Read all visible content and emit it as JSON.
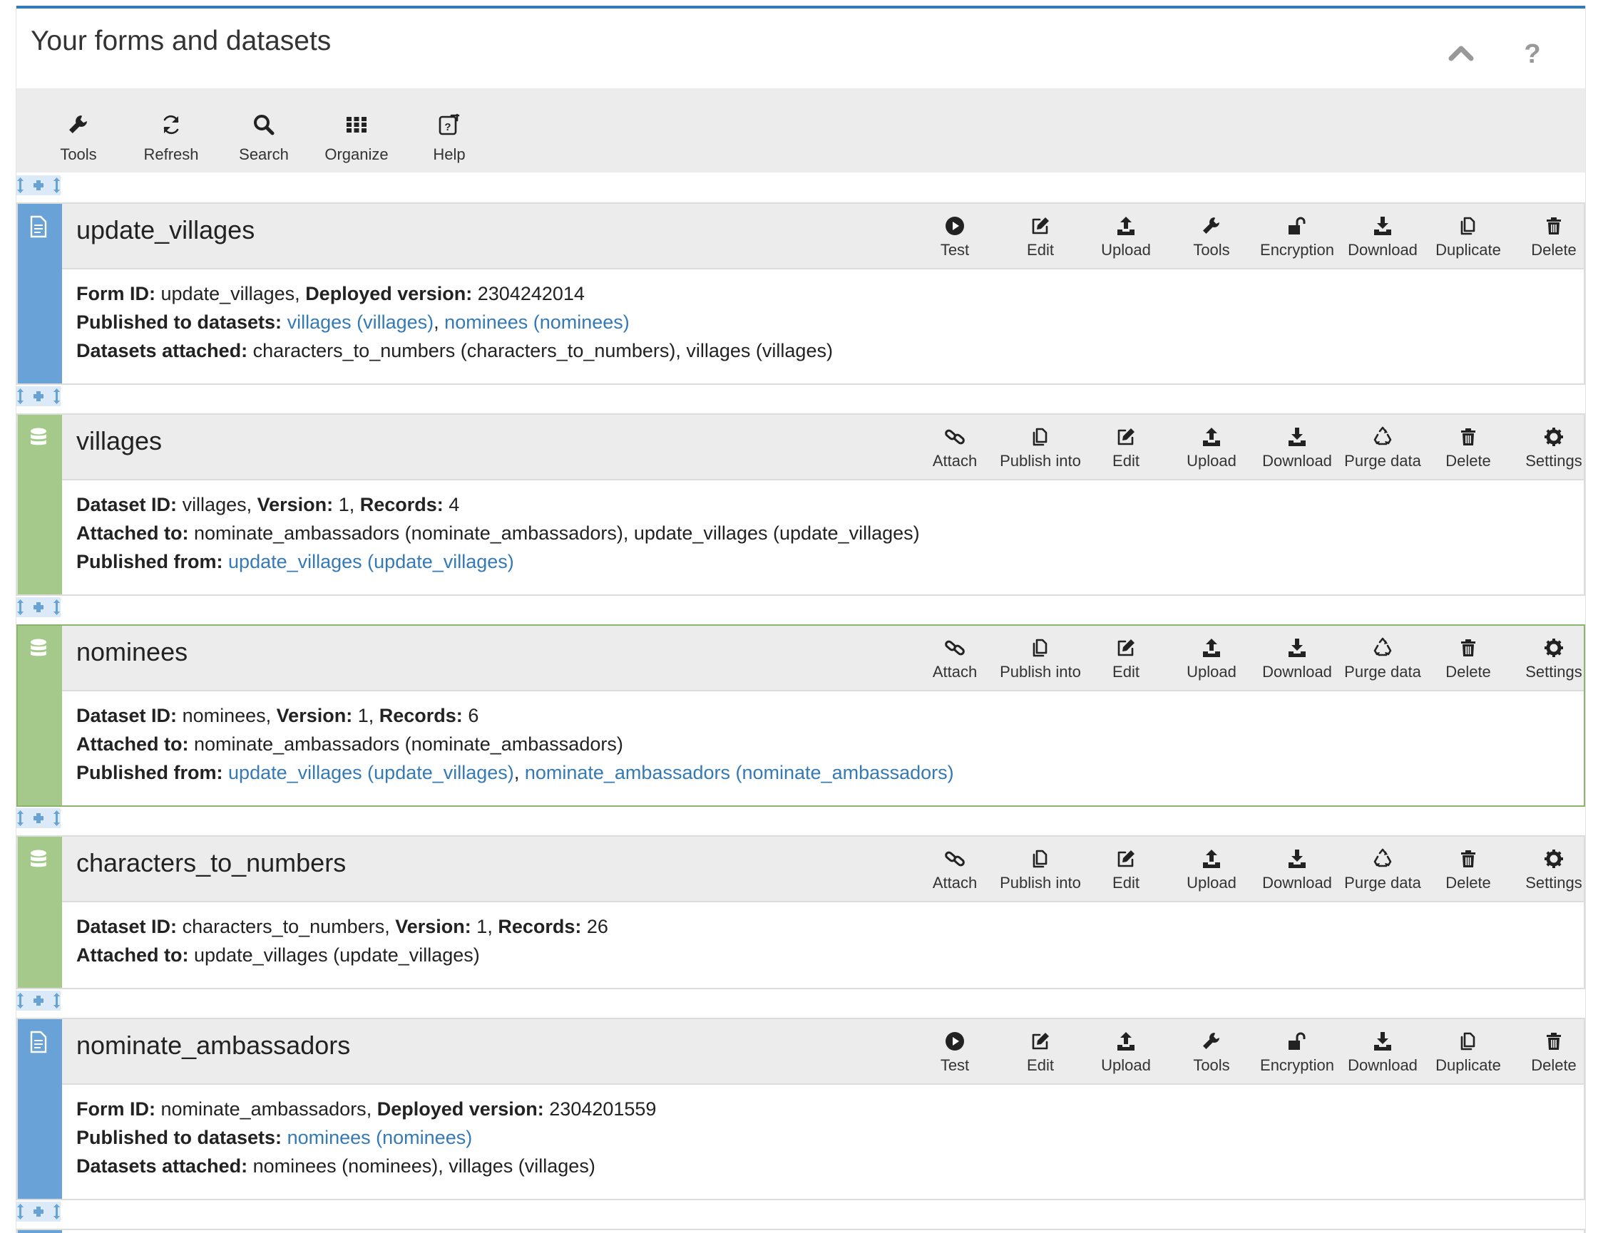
{
  "panel": {
    "title": "Your forms and datasets"
  },
  "toolbar": {
    "tools": "Tools",
    "refresh": "Refresh",
    "search": "Search",
    "organize": "Organize",
    "help": "Help"
  },
  "form_actions": {
    "test": "Test",
    "edit": "Edit",
    "upload": "Upload",
    "tools": "Tools",
    "encryption": "Encryption",
    "download": "Download",
    "duplicate": "Duplicate",
    "delete": "Delete"
  },
  "dataset_actions": {
    "attach": "Attach",
    "publish_into": "Publish into",
    "edit": "Edit",
    "upload": "Upload",
    "download": "Download",
    "purge_data": "Purge data",
    "delete": "Delete",
    "settings": "Settings"
  },
  "labels": {
    "form_id": "Form ID:",
    "deployed_version": "Deployed version:",
    "published_to_datasets": "Published to datasets:",
    "datasets_attached": "Datasets attached:",
    "dataset_id": "Dataset ID:",
    "version": "Version:",
    "records": "Records:",
    "attached_to": "Attached to:",
    "published_from": "Published from:"
  },
  "cards": [
    {
      "kind": "form",
      "title": "update_villages",
      "form_id": "update_villages",
      "deployed_version": "2304242014",
      "published_to": [
        "villages (villages)",
        "nominees (nominees)"
      ],
      "datasets_attached": "characters_to_numbers (characters_to_numbers), villages (villages)"
    },
    {
      "kind": "dataset",
      "title": "villages",
      "dataset_id": "villages",
      "version": "1",
      "records": "4",
      "attached_to": "nominate_ambassadors (nominate_ambassadors), update_villages (update_villages)",
      "published_from": [
        "update_villages (update_villages)"
      ]
    },
    {
      "kind": "dataset",
      "title": "nominees",
      "selected": true,
      "dataset_id": "nominees",
      "version": "1",
      "records": "6",
      "attached_to": "nominate_ambassadors (nominate_ambassadors)",
      "published_from": [
        "update_villages (update_villages)",
        "nominate_ambassadors (nominate_ambassadors)"
      ]
    },
    {
      "kind": "dataset",
      "title": "characters_to_numbers",
      "dataset_id": "characters_to_numbers",
      "version": "1",
      "records": "26",
      "attached_to": "update_villages (update_villages)"
    },
    {
      "kind": "form",
      "title": "nominate_ambassadors",
      "form_id": "nominate_ambassadors",
      "deployed_version": "2304201559",
      "published_to": [
        "nominees (nominees)"
      ],
      "datasets_attached": "nominees (nominees), villages (villages)"
    }
  ],
  "colors": {
    "form_strip": "#68a2d6",
    "dataset_strip": "#a4c98a",
    "link": "#337ab7",
    "accent": "#337ab7"
  },
  "icons": {
    "header": [
      "chevron-up-icon",
      "question-icon"
    ],
    "toolbar": [
      "wrench-icon",
      "refresh-icon",
      "search-icon",
      "grid-icon",
      "help-icon"
    ],
    "form": [
      "play-icon",
      "edit-icon",
      "upload-icon",
      "wrench-icon",
      "unlock-icon",
      "download-icon",
      "duplicate-icon",
      "trash-icon"
    ],
    "dataset": [
      "link-icon",
      "duplicate-icon",
      "edit-icon",
      "upload-icon",
      "download-icon",
      "recycle-icon",
      "trash-icon",
      "gear-icon"
    ]
  }
}
